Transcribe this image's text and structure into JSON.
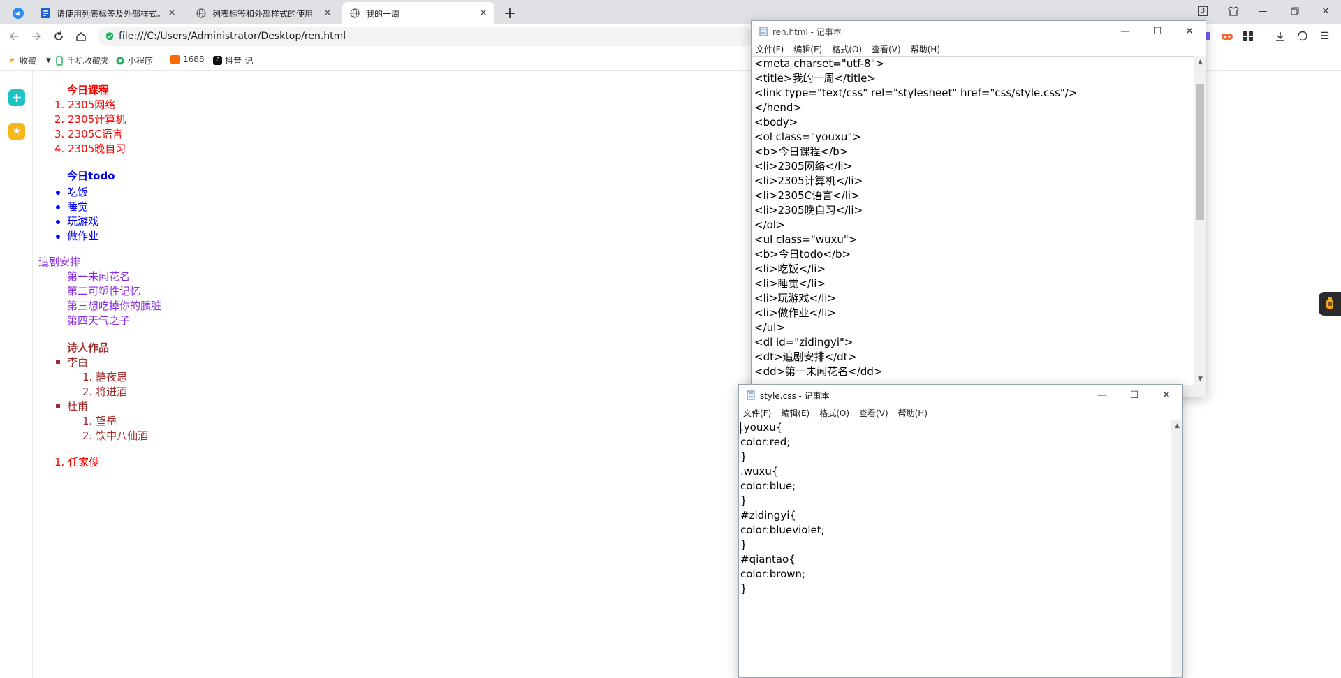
{
  "browser": {
    "tabs": [
      {
        "title": "请使用列表标签及外部样式。",
        "icon": "task-icon"
      },
      {
        "title": "列表标签和外部样式的使用",
        "icon": "globe-icon"
      },
      {
        "title": "我的一周",
        "icon": "globe-icon"
      }
    ],
    "tab_count": "3",
    "address": "file:///C:/Users/Administrator/Desktop/ren.html",
    "bookmarks": [
      {
        "label": "收藏",
        "icon": "star-icon"
      },
      {
        "label": "手机收藏夹",
        "icon": "phone-icon"
      },
      {
        "label": "小程序",
        "icon": "miniapp-icon"
      },
      {
        "label": "1688",
        "icon": "1688-icon"
      },
      {
        "label": "抖音-记",
        "icon": "douyin-icon"
      }
    ]
  },
  "page": {
    "course_title": "今日课程",
    "courses": [
      "1. 2305网络",
      "2. 2305计算机",
      "3. 2305C语言",
      "4. 2305晚自习"
    ],
    "todo_title": "今日todo",
    "todos": [
      "吃饭",
      "睡觉",
      "玩游戏",
      "做作业"
    ],
    "drama_term": "追剧安排",
    "dramas": [
      "第一未闻花名",
      "第二可塑性记忆",
      "第三想吃掉你的胰脏",
      "第四天气之子"
    ],
    "poet_title": "诗人作品",
    "poets": [
      {
        "name": "李白",
        "works": [
          "1. 静夜思",
          "2. 将进酒"
        ]
      },
      {
        "name": "杜甫",
        "works": [
          "1. 望岳",
          "2. 饮中八仙酒"
        ]
      }
    ],
    "extra": "1. 任家俊"
  },
  "notepad_html": {
    "title": "ren.html - 记事本",
    "menu": [
      "文件(F)",
      "编辑(E)",
      "格式(O)",
      "查看(V)",
      "帮助(H)"
    ],
    "lines": [
      "<meta charset=\"utf-8\">",
      "<title>我的一周</title>",
      "<link type=\"text/css\" rel=\"stylesheet\" href=\"css/style.css\"/>",
      "</hend>",
      "<body>",
      "<ol class=\"youxu\">",
      "<b>今日课程</b>",
      "<li>2305网络</li>",
      "<li>2305计算机</li>",
      "<li>2305C语言</li>",
      "<li>2305晚自习</li>",
      "</ol>",
      "<ul class=\"wuxu\">",
      "<b>今日todo</b>",
      "<li>吃饭</li>",
      "<li>睡觉</li>",
      "<li>玩游戏</li>",
      "<li>做作业</li>",
      "</ul>",
      "<dl id=\"zidingyi\">",
      "<dt>追剧安排</dt>",
      "<dd>第一未闻花名</dd>"
    ]
  },
  "notepad_css": {
    "title": "style.css - 记事本",
    "menu": [
      "文件(F)",
      "编辑(E)",
      "格式(O)",
      "查看(V)",
      "帮助(H)"
    ],
    "lines": [
      ".youxu{",
      "color:red;",
      "}",
      ".wuxu{",
      "color:blue;",
      "}",
      "#zidingyi{",
      "color:blueviolet;",
      "}",
      "#qiantao{",
      "color:brown;",
      "}"
    ]
  },
  "colors": {
    "red": "#ff0000",
    "blue": "#0000ff",
    "blueviolet": "#8a2be2",
    "brown": "#a52a2a"
  }
}
